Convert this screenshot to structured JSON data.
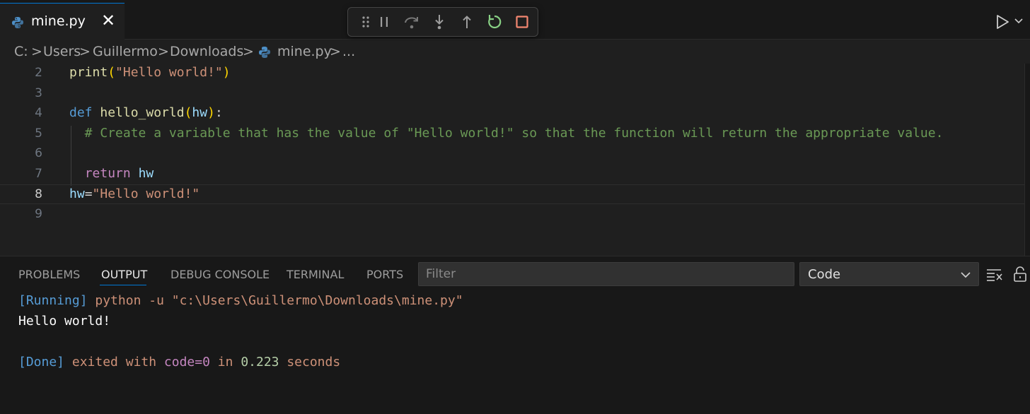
{
  "tab": {
    "filename": "mine.py",
    "close_glyph": "✕"
  },
  "breadcrumb": {
    "items": [
      "C:",
      "Users",
      "Guillermo",
      "Downloads",
      "mine.py",
      "..."
    ],
    "sep": ">"
  },
  "editor": {
    "active_line": 8,
    "lines": [
      {
        "num": "2",
        "tokens": [
          [
            "fn",
            "print"
          ],
          [
            "par",
            "("
          ],
          [
            "str",
            "\"Hello world!\""
          ],
          [
            "par",
            ")"
          ]
        ]
      },
      {
        "num": "3",
        "tokens": []
      },
      {
        "num": "4",
        "tokens": [
          [
            "kw",
            "def"
          ],
          [
            "plain",
            " "
          ],
          [
            "fn",
            "hello_world"
          ],
          [
            "par",
            "("
          ],
          [
            "var",
            "hw"
          ],
          [
            "par",
            ")"
          ],
          [
            "plain",
            ":"
          ]
        ]
      },
      {
        "num": "5",
        "tokens": [
          [
            "cm",
            "  # Create a variable that has the value of \"Hello world!\" so that the function will return the appropriate value."
          ]
        ]
      },
      {
        "num": "6",
        "tokens": []
      },
      {
        "num": "7",
        "tokens": [
          [
            "plain",
            "  "
          ],
          [
            "ctl",
            "return"
          ],
          [
            "plain",
            " "
          ],
          [
            "var",
            "hw"
          ]
        ]
      },
      {
        "num": "8",
        "tokens": [
          [
            "var",
            "hw"
          ],
          [
            "plain",
            "="
          ],
          [
            "str",
            "\"Hello world!\""
          ]
        ]
      },
      {
        "num": "9",
        "tokens": []
      }
    ]
  },
  "panel": {
    "tabs": [
      "PROBLEMS",
      "OUTPUT",
      "DEBUG CONSOLE",
      "TERMINAL",
      "PORTS"
    ],
    "active_tab": "OUTPUT",
    "filter_placeholder": "Filter",
    "output_channel": "Code",
    "output": {
      "l1_tag": "[Running]",
      "l1_cmd": " python -u \"c:\\Users\\Guillermo\\Downloads\\mine.py\"",
      "l2": "Hello world!",
      "l4_tag": "[Done]",
      "l4_a": " exited with ",
      "l4_code": "code=0",
      "l4_b": " in ",
      "l4_num": "0.223",
      "l4_c": " seconds"
    }
  },
  "icons": {
    "tab": "python-file-icon",
    "debug_toolbar": [
      "drag-handle-icon",
      "pause-icon",
      "step-over-icon",
      "step-into-icon",
      "step-out-icon",
      "restart-icon",
      "stop-icon"
    ],
    "run": "run-icon",
    "panel_actions": [
      "clear-output-icon",
      "lock-scroll-icon"
    ]
  },
  "colors": {
    "accent": "#0078d4",
    "restart": "#89d185",
    "stop": "#f48771"
  }
}
